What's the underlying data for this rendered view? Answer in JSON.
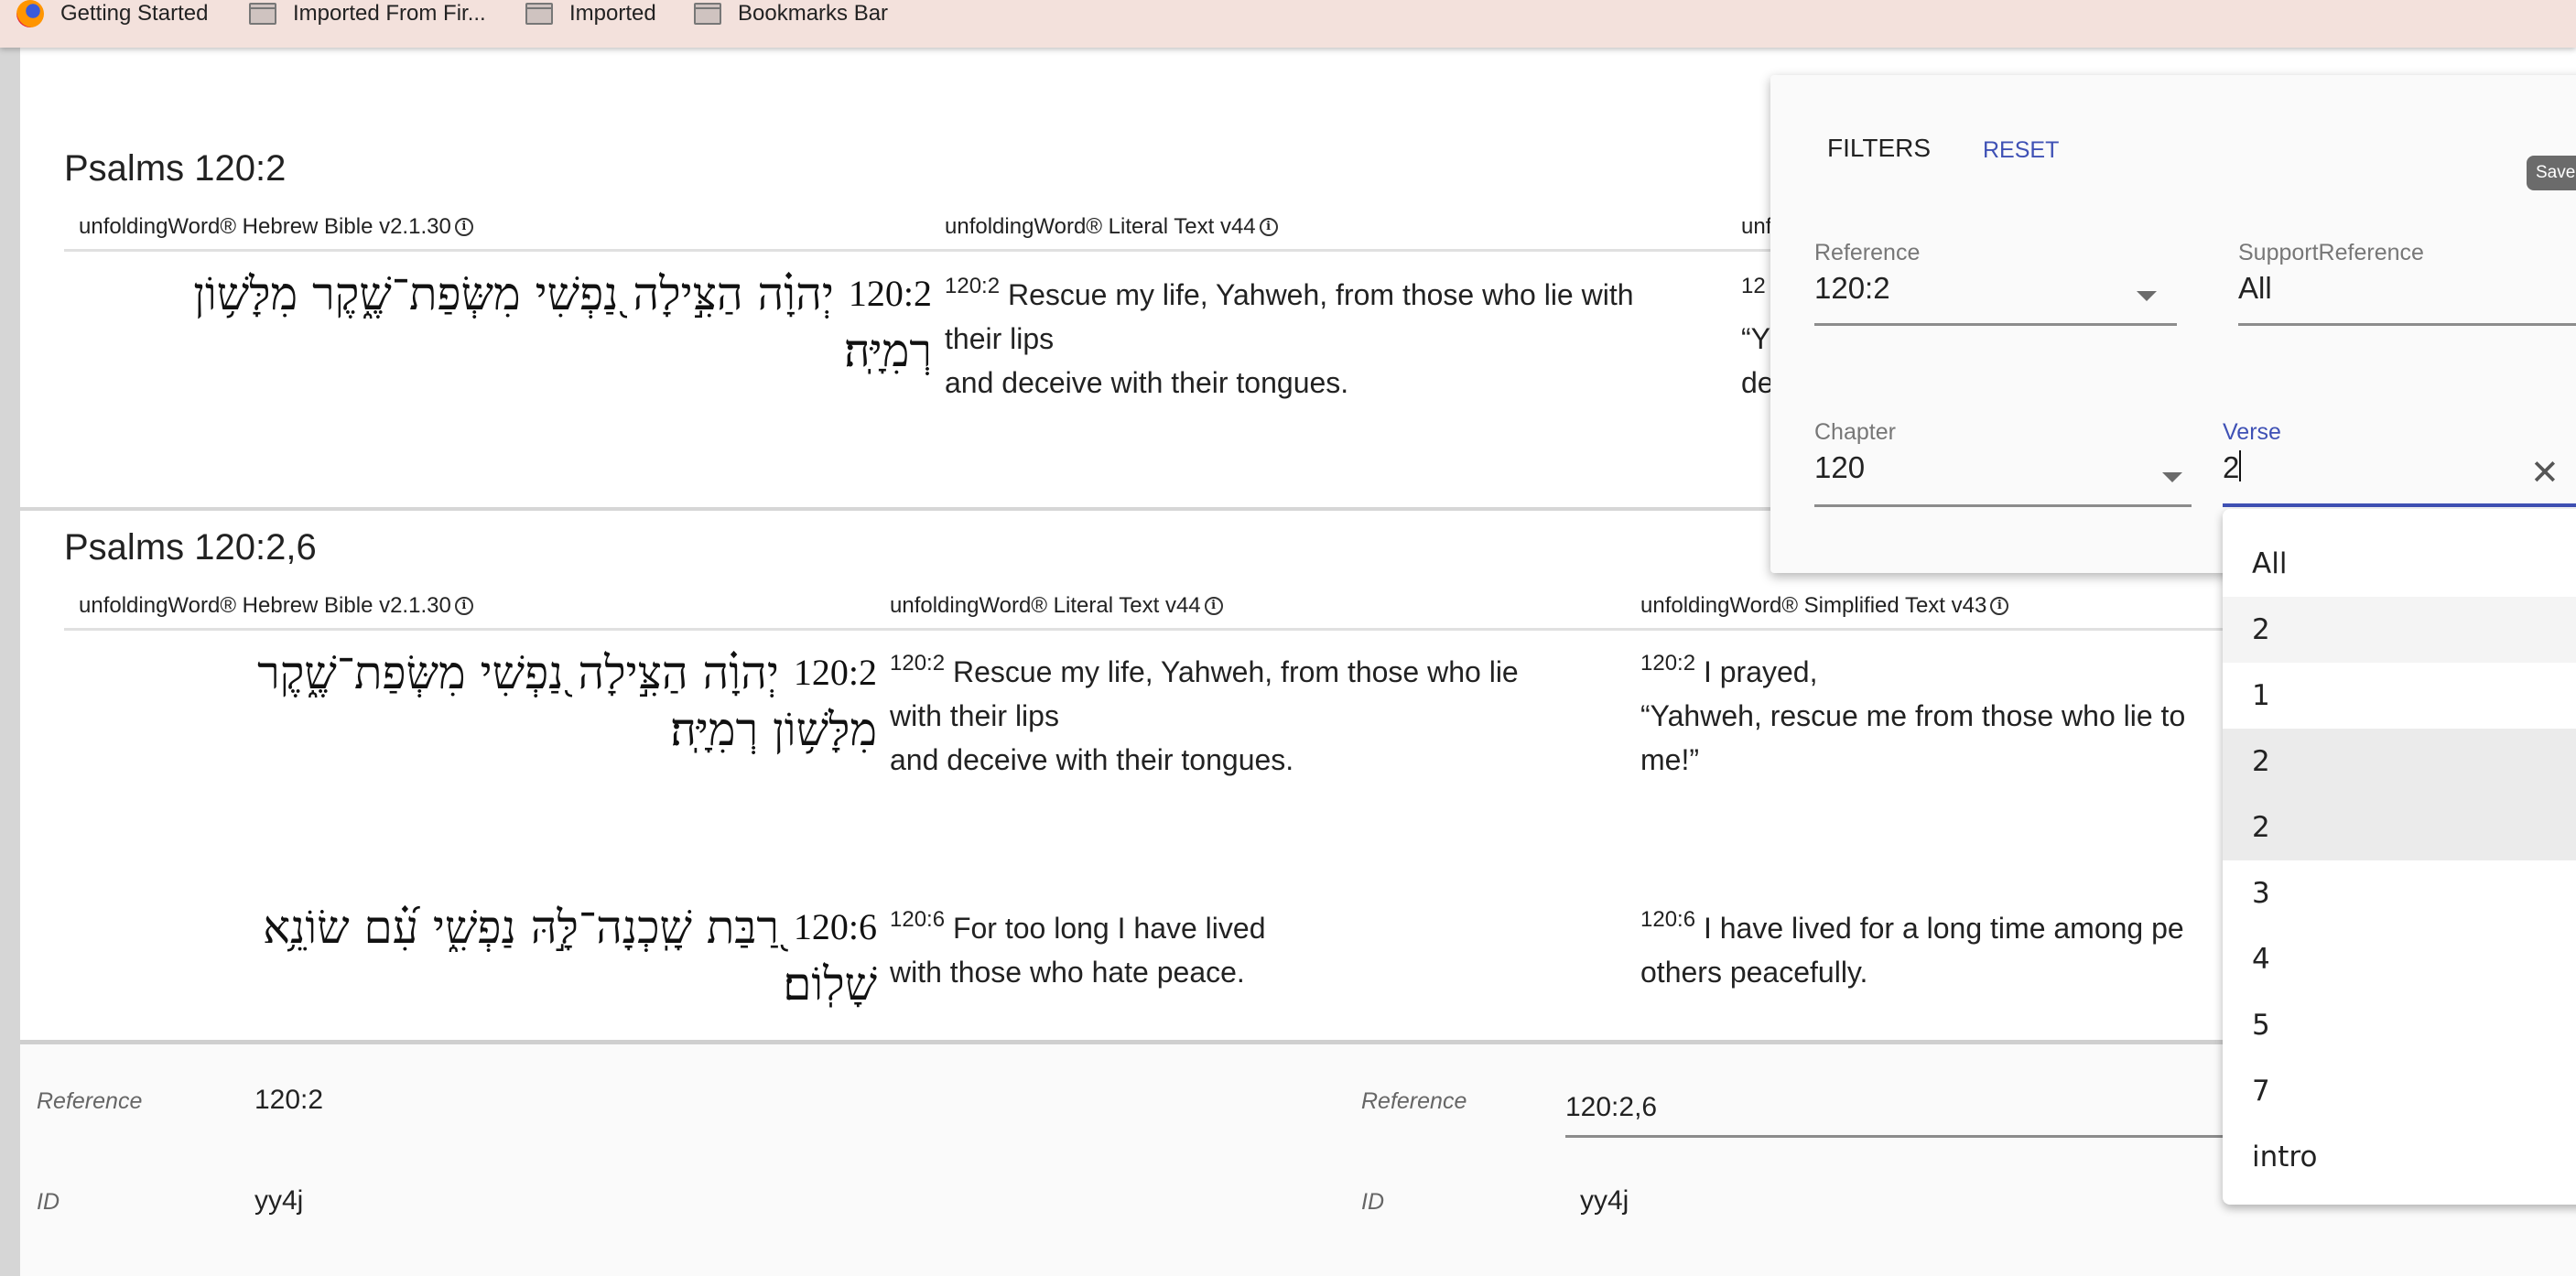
{
  "bookmarks": [
    {
      "label": "Getting Started",
      "icon": "firefox-icon"
    },
    {
      "label": "Imported From Fir...",
      "icon": "folder-icon"
    },
    {
      "label": "Imported",
      "icon": "folder-icon"
    },
    {
      "label": "Bookmarks Bar",
      "icon": "folder-icon"
    }
  ],
  "section1": {
    "title": "Psalms 120:2",
    "columns": [
      "unfoldingWord® Hebrew Bible v2.1.30",
      "unfoldingWord® Literal Text v44",
      "unf"
    ],
    "hebrew": {
      "verse": "120:2",
      "text": "יְהוָ֗ה הַצִּ֣ילָה נַ֭פְשִׁי מִשְּׂפַת־שֶׁ֑קֶר מִלָּשׁ֥וֹן רְמִיָּֽה׃"
    },
    "literal": {
      "verse": "120:2",
      "lines": [
        "Rescue my life, Yahweh, from those who lie with",
        "their lips",
        "and deceive with their tongues."
      ]
    },
    "simplified": {
      "verse": "12",
      "lines": [
        "“Y",
        "de"
      ]
    }
  },
  "section2": {
    "title": "Psalms 120:2,6",
    "columns": [
      "unfoldingWord® Hebrew Bible v2.1.30",
      "unfoldingWord® Literal Text v44",
      "unfoldingWord® Simplified Text v43"
    ],
    "rows": [
      {
        "hebrew": {
          "verse": "120:2",
          "text": "יְהוָ֗ה הַצִּ֣ילָה נַ֭פְשִׁי מִשְּׂפַת־שֶׁ֑קֶר מִלָּשׁ֥וֹן רְמִיָּֽה׃"
        },
        "literal": {
          "verse": "120:2",
          "lines": [
            "Rescue my life, Yahweh, from those who lie",
            "with their lips",
            "and deceive with their tongues."
          ]
        },
        "simplified": {
          "verse": "120:2",
          "lines": [
            "I prayed,",
            "“Yahweh, rescue me from those who lie to",
            "me!”"
          ]
        }
      },
      {
        "hebrew": {
          "verse": "120:6",
          "text": "רַ֭בַּת שָֽׁכְנָה־לָּ֣הּ נַפְשִׁ֑י עִ֝֗ם שׂוֹנֵ֥א שָׁלֽוֹם׃"
        },
        "literal": {
          "verse": "120:6",
          "lines": [
            "For too long I have lived",
            "with those who hate peace."
          ]
        },
        "simplified": {
          "verse": "120:6",
          "lines": [
            "I have lived for a long time among pe",
            "others peacefully."
          ]
        }
      }
    ]
  },
  "footer": {
    "left": {
      "reference_label": "Reference",
      "reference": "120:2",
      "id_label": "ID",
      "id": "yy4j"
    },
    "right": {
      "reference_label": "Reference",
      "reference": "120:2,6",
      "id_label": "ID",
      "id": "yy4j"
    }
  },
  "filters": {
    "title": "FILTERS",
    "reset": "RESET",
    "save": "Save",
    "reference": {
      "label": "Reference",
      "value": "120:2"
    },
    "support_reference": {
      "label": "SupportReference",
      "value": "All"
    },
    "chapter": {
      "label": "Chapter",
      "value": "120"
    },
    "verse": {
      "label": "Verse",
      "value": "2"
    },
    "verse_options": [
      "All",
      "2",
      "1",
      "2",
      "2",
      "3",
      "4",
      "5",
      "7",
      "intro"
    ],
    "accent": "#3f51b5"
  }
}
